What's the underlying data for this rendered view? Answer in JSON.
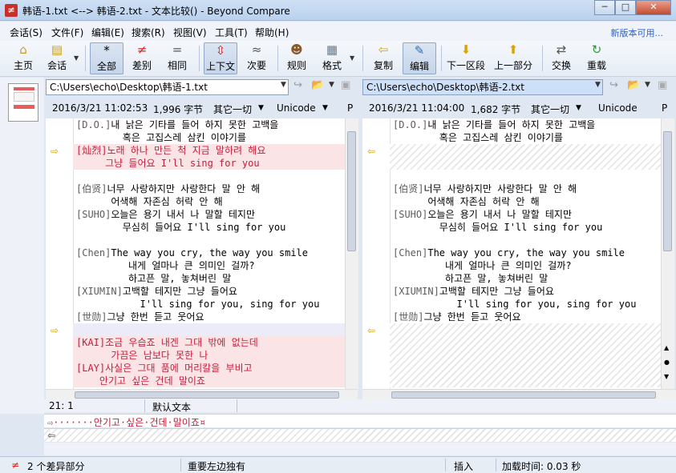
{
  "window": {
    "title": "韩语-1.txt <--> 韩语-2.txt - 文本比较() - Beyond Compare",
    "minimize": "─",
    "maximize": "□",
    "close": "✕"
  },
  "menu": {
    "items": [
      "会话(S)",
      "文件(F)",
      "编辑(E)",
      "搜索(R)",
      "视图(V)",
      "工具(T)",
      "帮助(H)"
    ],
    "new_version": "新版本可用..."
  },
  "toolbar": {
    "buttons": [
      {
        "label": "主页",
        "icon": "home-icon"
      },
      {
        "label": "会话",
        "icon": "session-icon"
      },
      {
        "label": "全部",
        "icon": "asterisk-icon",
        "pressed": true
      },
      {
        "label": "差别",
        "icon": "not-equal-icon"
      },
      {
        "label": "相同",
        "icon": "equal-icon"
      },
      {
        "label": "上下文",
        "icon": "context-icon",
        "pressed": true
      },
      {
        "label": "次要",
        "icon": "minor-icon"
      },
      {
        "label": "规则",
        "icon": "rules-icon"
      },
      {
        "label": "格式",
        "icon": "format-icon"
      },
      {
        "label": "复制",
        "icon": "copy-arrow-icon"
      },
      {
        "label": "编辑",
        "icon": "edit-icon",
        "pressed": true
      },
      {
        "label": "下一区段",
        "icon": "down-arrow-icon"
      },
      {
        "label": "上一部分",
        "icon": "up-arrow-icon"
      },
      {
        "label": "交换",
        "icon": "swap-icon"
      },
      {
        "label": "重载",
        "icon": "reload-icon"
      }
    ]
  },
  "left": {
    "path": "C:\\Users\\echo\\Desktop\\韩语-1.txt",
    "date": "2016/3/21 11:02:53",
    "size": "1,996 字节",
    "mode": "其它一切",
    "encoding": "Unicode",
    "extra": "P"
  },
  "right": {
    "path": "C:\\Users\\echo\\Desktop\\韩语-2.txt",
    "date": "2016/3/21 11:04:00",
    "size": "1,682 字节",
    "mode": "其它一切",
    "encoding": "Unicode",
    "extra": "P"
  },
  "left_lines": [
    {
      "tag": "[D.O.]",
      "text": "내 낡은 기타를 들어 하지 못한 고백을",
      "diff": false
    },
    {
      "tag": "",
      "text": "        혹은 고집스레 삼킨 이야기를",
      "diff": false
    },
    {
      "tag": "[灿烈]",
      "text": "노래 하나 만든 척 지금 말하려 해요",
      "diff": true
    },
    {
      "tag": "",
      "text": "     그냥 들어요 I'll sing for you",
      "diff": true
    },
    {
      "tag": "",
      "text": "",
      "diff": false
    },
    {
      "tag": "[伯贤]",
      "text": "너무 사랑하지만 사랑한다 말 안 해",
      "diff": false
    },
    {
      "tag": "",
      "text": "      어색해 자존심 허락 안 해",
      "diff": false
    },
    {
      "tag": "[SUHO]",
      "text": "오늘은 용기 내서 나 말할 테지만",
      "diff": false
    },
    {
      "tag": "",
      "text": "        무심히 들어요 I'll sing for you",
      "diff": false
    },
    {
      "tag": "",
      "text": "",
      "diff": false
    },
    {
      "tag": "[Chen]",
      "text": "The way you cry, the way you smile",
      "diff": false
    },
    {
      "tag": "",
      "text": "         내게 얼마나 큰 의미인 걸까?",
      "diff": false
    },
    {
      "tag": "",
      "text": "         하고픈 말, 놓쳐버린 말",
      "diff": false
    },
    {
      "tag": "[XIUMIN]",
      "text": "고백할 테지만 그냥 들어요",
      "diff": false
    },
    {
      "tag": "",
      "text": "           I'll sing for you, sing for you",
      "diff": false
    },
    {
      "tag": "[世勋]",
      "text": "그냥 한번 듣고 웃어요",
      "diff": false
    },
    {
      "tag": "",
      "text": "",
      "diff": false
    },
    {
      "tag": "[KAI]",
      "text": "조금 우습죠 내겐 그대 밖에 없는데",
      "diff": true
    },
    {
      "tag": "",
      "text": "      가끔은 남보다 못한 나",
      "diff": true
    },
    {
      "tag": "[LAY]",
      "text": "사실은 그대 품에 머리칼을 부비고",
      "diff": true
    },
    {
      "tag": "",
      "text": "    안기고 싶은 건데 말이죠",
      "diff": true
    }
  ],
  "right_lines": [
    {
      "tag": "[D.O.]",
      "text": "내 낡은 기타를 들어 하지 못한 고백을"
    },
    {
      "tag": "",
      "text": "        혹은 고집스레 삼킨 이야기를"
    },
    {
      "tag": "[伯贤]",
      "text": "너무 사랑하지만 사랑한다 말 안 해"
    },
    {
      "tag": "",
      "text": "      어색해 자존심 허락 안 해"
    },
    {
      "tag": "[SUHO]",
      "text": "오늘은 용기 내서 나 말할 테지만"
    },
    {
      "tag": "",
      "text": "        무심히 들어요 I'll sing for you"
    },
    {
      "tag": "",
      "text": ""
    },
    {
      "tag": "[Chen]",
      "text": "The way you cry, the way you smile"
    },
    {
      "tag": "",
      "text": "         내게 얼마나 큰 의미인 걸까?"
    },
    {
      "tag": "",
      "text": "         하고픈 말, 놓쳐버린 말"
    },
    {
      "tag": "[XIUMIN]",
      "text": "고백할 테지만 그냥 들어요"
    },
    {
      "tag": "",
      "text": "           I'll sing for you, sing for you"
    },
    {
      "tag": "[世勋]",
      "text": "그냥 한번 듣고 웃어요"
    }
  ],
  "position": {
    "cursor": "21: 1",
    "style": "默认文本"
  },
  "detail": {
    "line1": "⇨·······안기고·싶은·건데·말이죠¤"
  },
  "status": {
    "diffs": "2 个差异部分",
    "important": "重要左边独有",
    "insert": "插入",
    "load_time": "加载时间: 0.03 秒"
  }
}
